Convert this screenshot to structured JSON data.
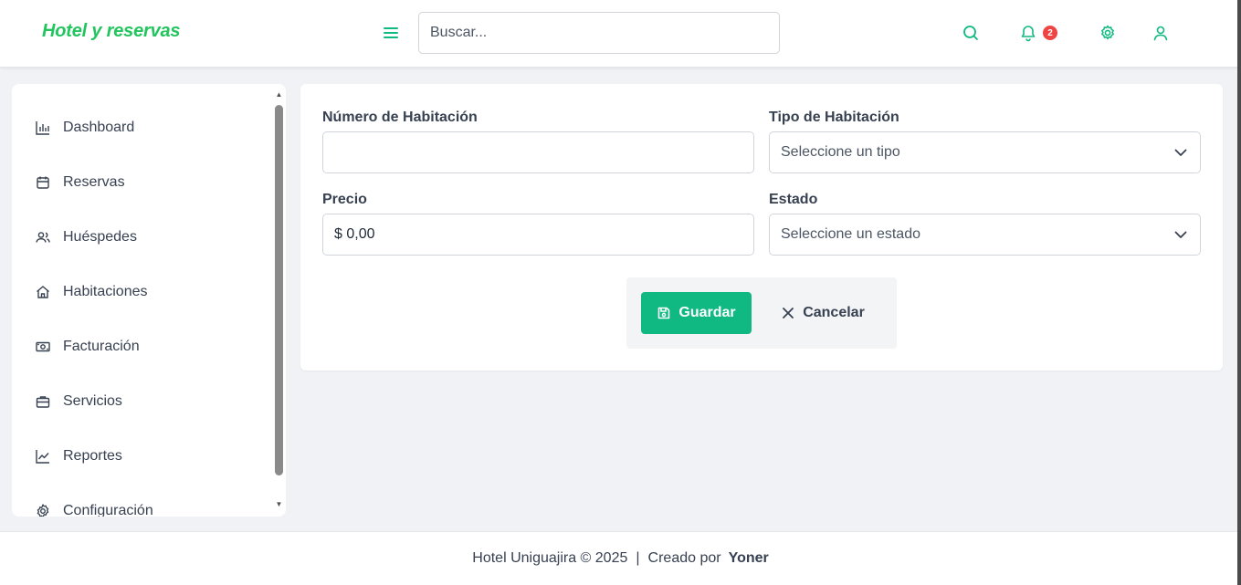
{
  "header": {
    "brand": "Hotel y reservas",
    "search_placeholder": "Buscar...",
    "notifications_count": "2",
    "icons": [
      "menu-icon",
      "search-icon",
      "bell-icon",
      "gear-icon",
      "user-icon"
    ]
  },
  "sidebar": {
    "items": [
      {
        "label": "Dashboard",
        "icon": "bar-chart-icon"
      },
      {
        "label": "Reservas",
        "icon": "calendar-icon"
      },
      {
        "label": "Huéspedes",
        "icon": "users-icon"
      },
      {
        "label": "Habitaciones",
        "icon": "home-icon"
      },
      {
        "label": "Facturación",
        "icon": "banknote-icon"
      },
      {
        "label": "Servicios",
        "icon": "briefcase-icon"
      },
      {
        "label": "Reportes",
        "icon": "line-chart-icon"
      },
      {
        "label": "Configuración",
        "icon": "gear-icon"
      }
    ]
  },
  "form": {
    "room_number_label": "Número de Habitación",
    "room_number_value": "",
    "room_type_label": "Tipo de Habitación",
    "room_type_value": "Seleccione un tipo",
    "price_label": "Precio",
    "price_value": "$ 0,00",
    "status_label": "Estado",
    "status_value": "Seleccione un estado",
    "save_label": "Guardar",
    "cancel_label": "Cancelar"
  },
  "footer": {
    "copyright": "Hotel Uniguajira © 2025",
    "separator": "|",
    "created_by": "Creado por",
    "author": "Yoner"
  },
  "colors": {
    "accent": "#22c55e",
    "save_button": "#10b981",
    "badge": "#ef4444",
    "background": "#f0f2f5"
  }
}
